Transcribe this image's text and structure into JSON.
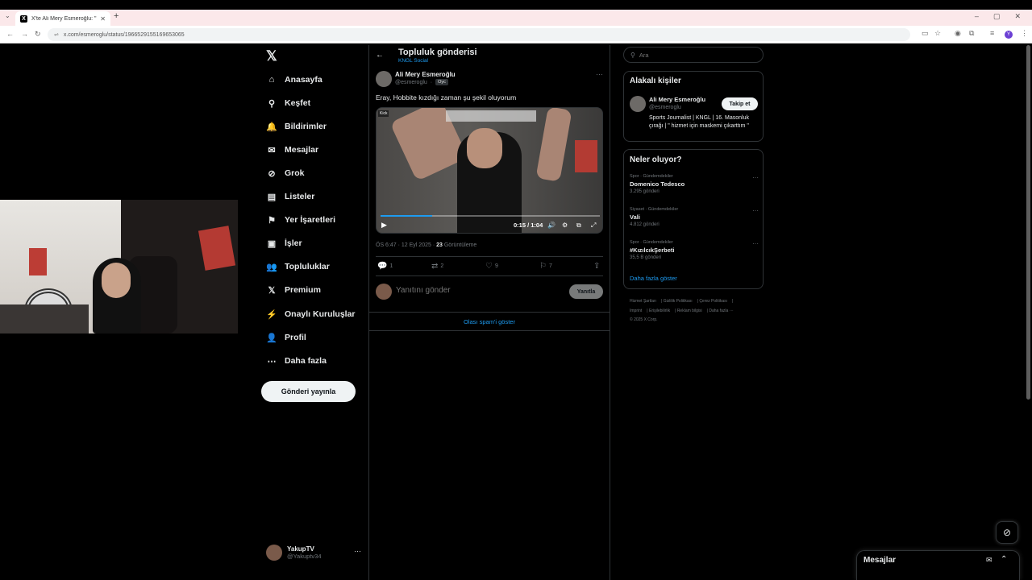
{
  "browser": {
    "tab_title": "X'te Ali Mery Esmeroğlu: \"Eray,",
    "tab_favicon": "X",
    "tab_close": "✕",
    "new_tab": "+",
    "url_site": "⇌",
    "url": "x.com/esmeroglu/status/1966529155169653065",
    "window_controls": [
      "–",
      "▢",
      "✕"
    ]
  },
  "sidebar": {
    "logo": "𝕏",
    "items": [
      {
        "label": "Anasayfa",
        "icon": "⌂"
      },
      {
        "label": "Keşfet",
        "icon": "⚲"
      },
      {
        "label": "Bildirimler",
        "icon": "🔔"
      },
      {
        "label": "Mesajlar",
        "icon": "✉"
      },
      {
        "label": "Grok",
        "icon": "⊘"
      },
      {
        "label": "Listeler",
        "icon": "▤"
      },
      {
        "label": "Yer İşaretleri",
        "icon": "⚑"
      },
      {
        "label": "İşler",
        "icon": "▣"
      },
      {
        "label": "Topluluklar",
        "icon": "👥"
      },
      {
        "label": "Premium",
        "icon": "𝕏"
      },
      {
        "label": "Onaylı Kuruluşlar",
        "icon": "⚡"
      },
      {
        "label": "Profil",
        "icon": "👤"
      },
      {
        "label": "Daha fazla",
        "icon": "⋯"
      }
    ],
    "post_button": "Gönderi yayınla",
    "me": {
      "name": "YakupTV",
      "handle": "@Yakuptv34",
      "more": "···"
    }
  },
  "header": {
    "back": "←",
    "title": "Topluluk gönderisi",
    "community": "KNGL Social"
  },
  "post": {
    "author": "Ali Mery Esmeroğlu",
    "handle": "@esmeroglu",
    "dot": "·",
    "tag": "Oyc",
    "more": "···",
    "text": "Eray, Hobbite kızdığı zaman şu şekil oluyorum",
    "video": {
      "brand": "Kick",
      "time": "0:15 / 1:04",
      "progress": 0.234,
      "play": "▶",
      "icons": [
        "🔊",
        "⚙",
        "⧉",
        "⤢"
      ]
    },
    "meta_time": "ÖS 6:47 · 12 Eyl 2025 · ",
    "views": "23",
    "views_label": " Görüntüleme",
    "actions": {
      "replies": "1",
      "reposts": "2",
      "likes": "9",
      "bookmarks": "7"
    }
  },
  "reply": {
    "placeholder": "Yanıtını gönder",
    "button": "Yanıtla"
  },
  "spam_link": "Olası spam'i göster",
  "search": {
    "placeholder": "Ara"
  },
  "related": {
    "title": "Alakalı kişiler",
    "name": "Ali Mery Esmeroğlu",
    "handle": "@esmeroglu",
    "follow": "Takip et",
    "bio": "Sports Journalist | KNGL | 16. Masonluk çırağı | \" hizmet için maskemi çıkarttım \""
  },
  "trends": {
    "title": "Neler oluyor?",
    "items": [
      {
        "category": "Spor · Gündemdekiler",
        "name": "Domenico Tedesco",
        "count": "3.295 gönderi"
      },
      {
        "category": "Siyaset · Gündemdekiler",
        "name": "Vali",
        "count": "4.812 gönderi"
      },
      {
        "category": "Spor · Gündemdekiler",
        "name": "#KızılcıkŞerbeti",
        "count": "35,5 B gönderi"
      }
    ],
    "more": "Daha fazla göster"
  },
  "footer": {
    "links": [
      "Hizmet Şartları",
      "Gizlilik Politikası",
      "Çerez Politikası",
      "Imprint",
      "Erişilebilirlik",
      "Reklam bilgisi",
      "Daha fazla ···"
    ],
    "copyright": "© 2025 X Corp."
  },
  "messages_drawer": {
    "title": "Mesajlar"
  },
  "grok_fab": "⊘",
  "colors": {
    "accent": "#1d9bf0",
    "background": "#000000",
    "border": "#2f3336",
    "muted": "#71767b"
  }
}
